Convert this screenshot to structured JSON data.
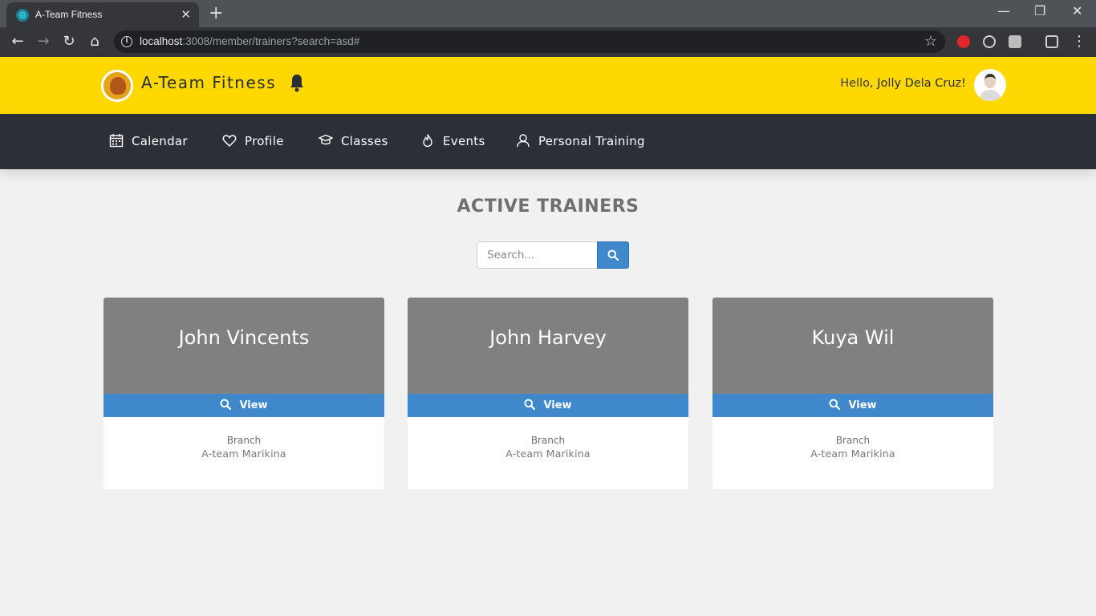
{
  "browser": {
    "tab_title": "A-Team Fitness",
    "tab_close": "✕",
    "new_tab": "+",
    "url_host": "localhost",
    "url_rest": ":3008/member/trainers?search=asd#",
    "window_controls": [
      "—",
      "❐",
      "✕"
    ]
  },
  "header": {
    "brand": "A-Team Fitness",
    "greeting_prefix": "Hello, ",
    "user_name": "Jolly Dela Cruz!"
  },
  "nav": {
    "items": [
      {
        "label": "Calendar",
        "icon": "calendar-icon"
      },
      {
        "label": "Profile",
        "icon": "heart-icon"
      },
      {
        "label": "Classes",
        "icon": "graduation-cap-icon"
      },
      {
        "label": "Events",
        "icon": "flame-icon"
      },
      {
        "label": "Personal Training",
        "icon": "user-icon"
      }
    ]
  },
  "main": {
    "title": "ACTIVE TRAINERS",
    "search": {
      "placeholder": "Search...",
      "value": ""
    },
    "trainers": [
      {
        "name": "John Vincents",
        "view_label": "View",
        "branch_label": "Branch",
        "branch": "A-team Marikina"
      },
      {
        "name": "John Harvey",
        "view_label": "View",
        "branch_label": "Branch",
        "branch": "A-team Marikina"
      },
      {
        "name": "Kuya Wil",
        "view_label": "View",
        "branch_label": "Branch",
        "branch": "A-team Marikina"
      }
    ]
  },
  "colors": {
    "header_yellow": "#fed800",
    "nav_dark": "#2c2f38",
    "accent_blue": "#3f88cb",
    "card_gray": "#808080"
  }
}
